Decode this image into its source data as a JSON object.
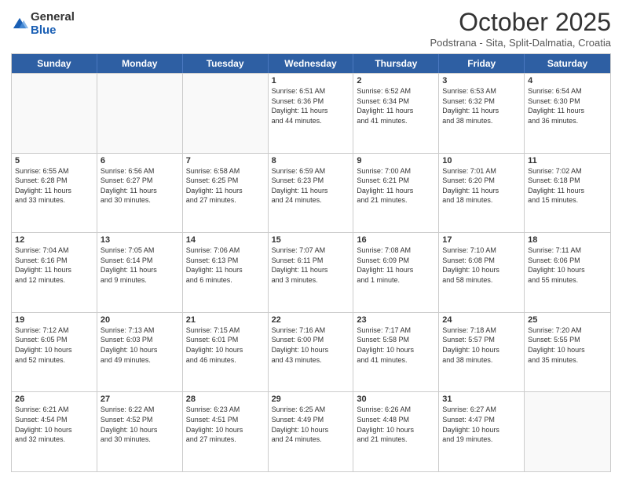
{
  "logo": {
    "general": "General",
    "blue": "Blue"
  },
  "header": {
    "month": "October 2025",
    "location": "Podstrana - Sita, Split-Dalmatia, Croatia"
  },
  "weekdays": [
    "Sunday",
    "Monday",
    "Tuesday",
    "Wednesday",
    "Thursday",
    "Friday",
    "Saturday"
  ],
  "weeks": [
    [
      {
        "day": "",
        "info": "",
        "empty": true
      },
      {
        "day": "",
        "info": "",
        "empty": true
      },
      {
        "day": "",
        "info": "",
        "empty": true
      },
      {
        "day": "1",
        "info": "Sunrise: 6:51 AM\nSunset: 6:36 PM\nDaylight: 11 hours\nand 44 minutes."
      },
      {
        "day": "2",
        "info": "Sunrise: 6:52 AM\nSunset: 6:34 PM\nDaylight: 11 hours\nand 41 minutes."
      },
      {
        "day": "3",
        "info": "Sunrise: 6:53 AM\nSunset: 6:32 PM\nDaylight: 11 hours\nand 38 minutes."
      },
      {
        "day": "4",
        "info": "Sunrise: 6:54 AM\nSunset: 6:30 PM\nDaylight: 11 hours\nand 36 minutes."
      }
    ],
    [
      {
        "day": "5",
        "info": "Sunrise: 6:55 AM\nSunset: 6:28 PM\nDaylight: 11 hours\nand 33 minutes."
      },
      {
        "day": "6",
        "info": "Sunrise: 6:56 AM\nSunset: 6:27 PM\nDaylight: 11 hours\nand 30 minutes."
      },
      {
        "day": "7",
        "info": "Sunrise: 6:58 AM\nSunset: 6:25 PM\nDaylight: 11 hours\nand 27 minutes."
      },
      {
        "day": "8",
        "info": "Sunrise: 6:59 AM\nSunset: 6:23 PM\nDaylight: 11 hours\nand 24 minutes."
      },
      {
        "day": "9",
        "info": "Sunrise: 7:00 AM\nSunset: 6:21 PM\nDaylight: 11 hours\nand 21 minutes."
      },
      {
        "day": "10",
        "info": "Sunrise: 7:01 AM\nSunset: 6:20 PM\nDaylight: 11 hours\nand 18 minutes."
      },
      {
        "day": "11",
        "info": "Sunrise: 7:02 AM\nSunset: 6:18 PM\nDaylight: 11 hours\nand 15 minutes."
      }
    ],
    [
      {
        "day": "12",
        "info": "Sunrise: 7:04 AM\nSunset: 6:16 PM\nDaylight: 11 hours\nand 12 minutes."
      },
      {
        "day": "13",
        "info": "Sunrise: 7:05 AM\nSunset: 6:14 PM\nDaylight: 11 hours\nand 9 minutes."
      },
      {
        "day": "14",
        "info": "Sunrise: 7:06 AM\nSunset: 6:13 PM\nDaylight: 11 hours\nand 6 minutes."
      },
      {
        "day": "15",
        "info": "Sunrise: 7:07 AM\nSunset: 6:11 PM\nDaylight: 11 hours\nand 3 minutes."
      },
      {
        "day": "16",
        "info": "Sunrise: 7:08 AM\nSunset: 6:09 PM\nDaylight: 11 hours\nand 1 minute."
      },
      {
        "day": "17",
        "info": "Sunrise: 7:10 AM\nSunset: 6:08 PM\nDaylight: 10 hours\nand 58 minutes."
      },
      {
        "day": "18",
        "info": "Sunrise: 7:11 AM\nSunset: 6:06 PM\nDaylight: 10 hours\nand 55 minutes."
      }
    ],
    [
      {
        "day": "19",
        "info": "Sunrise: 7:12 AM\nSunset: 6:05 PM\nDaylight: 10 hours\nand 52 minutes."
      },
      {
        "day": "20",
        "info": "Sunrise: 7:13 AM\nSunset: 6:03 PM\nDaylight: 10 hours\nand 49 minutes."
      },
      {
        "day": "21",
        "info": "Sunrise: 7:15 AM\nSunset: 6:01 PM\nDaylight: 10 hours\nand 46 minutes."
      },
      {
        "day": "22",
        "info": "Sunrise: 7:16 AM\nSunset: 6:00 PM\nDaylight: 10 hours\nand 43 minutes."
      },
      {
        "day": "23",
        "info": "Sunrise: 7:17 AM\nSunset: 5:58 PM\nDaylight: 10 hours\nand 41 minutes."
      },
      {
        "day": "24",
        "info": "Sunrise: 7:18 AM\nSunset: 5:57 PM\nDaylight: 10 hours\nand 38 minutes."
      },
      {
        "day": "25",
        "info": "Sunrise: 7:20 AM\nSunset: 5:55 PM\nDaylight: 10 hours\nand 35 minutes."
      }
    ],
    [
      {
        "day": "26",
        "info": "Sunrise: 6:21 AM\nSunset: 4:54 PM\nDaylight: 10 hours\nand 32 minutes."
      },
      {
        "day": "27",
        "info": "Sunrise: 6:22 AM\nSunset: 4:52 PM\nDaylight: 10 hours\nand 30 minutes."
      },
      {
        "day": "28",
        "info": "Sunrise: 6:23 AM\nSunset: 4:51 PM\nDaylight: 10 hours\nand 27 minutes."
      },
      {
        "day": "29",
        "info": "Sunrise: 6:25 AM\nSunset: 4:49 PM\nDaylight: 10 hours\nand 24 minutes."
      },
      {
        "day": "30",
        "info": "Sunrise: 6:26 AM\nSunset: 4:48 PM\nDaylight: 10 hours\nand 21 minutes."
      },
      {
        "day": "31",
        "info": "Sunrise: 6:27 AM\nSunset: 4:47 PM\nDaylight: 10 hours\nand 19 minutes."
      },
      {
        "day": "",
        "info": "",
        "empty": true
      }
    ]
  ]
}
